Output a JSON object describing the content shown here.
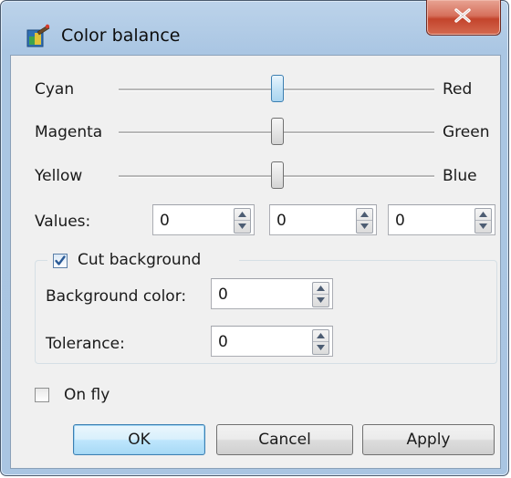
{
  "window": {
    "title": "Color balance",
    "close_symbol": "X"
  },
  "sliders": [
    {
      "left_label": "Cyan",
      "right_label": "Red",
      "value": 0,
      "range": [
        -100,
        100
      ],
      "focused": true
    },
    {
      "left_label": "Magenta",
      "right_label": "Green",
      "value": 0,
      "range": [
        -100,
        100
      ],
      "focused": false
    },
    {
      "left_label": "Yellow",
      "right_label": "Blue",
      "value": 0,
      "range": [
        -100,
        100
      ],
      "focused": false
    }
  ],
  "values": {
    "label": "Values:",
    "fields": [
      "0",
      "0",
      "0"
    ]
  },
  "cut_background": {
    "label": "Cut background",
    "checked": true,
    "background_color_label": "Background color:",
    "background_color_value": "0",
    "tolerance_label": "Tolerance:",
    "tolerance_value": "0"
  },
  "on_fly": {
    "label": "On fly",
    "checked": false
  },
  "buttons": {
    "ok": "OK",
    "cancel": "Cancel",
    "apply": "Apply"
  },
  "colors": {
    "accent": "#3c7fb1",
    "close_button": "#c3442c",
    "frame": "#aac6e3"
  },
  "icons": {
    "app": "color-balance-app-icon",
    "close": "close-icon",
    "check": "checkmark-icon",
    "spin_up": "arrow-up-icon",
    "spin_down": "arrow-down-icon"
  }
}
